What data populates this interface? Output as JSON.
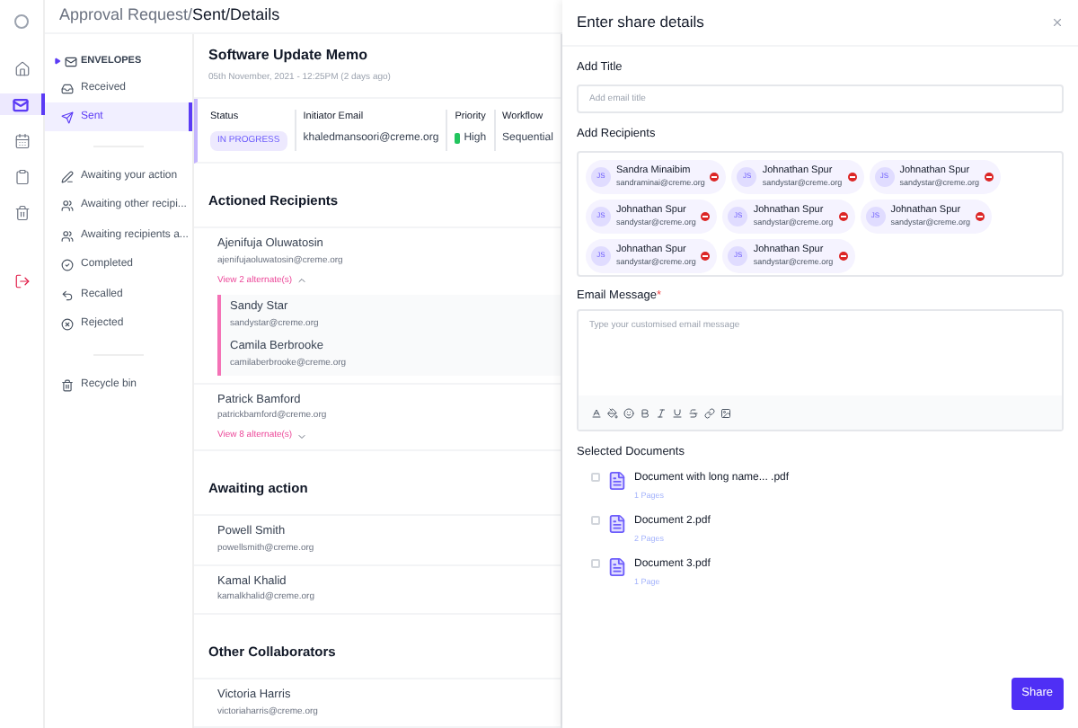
{
  "rail": [
    {
      "selected": false
    },
    {
      "selected": true
    },
    {
      "selected": false
    },
    {
      "selected": false
    },
    {
      "selected": false
    },
    {
      "selected": false
    }
  ],
  "breadcrumb": {
    "parent": "Approval Request/",
    "current": "Sent/Details"
  },
  "sidebar": {
    "group": {
      "label": "ENVELOPES",
      "expanded": true
    },
    "items": [
      {
        "label": "Received",
        "selected": false
      },
      {
        "label": "Sent",
        "selected": true
      }
    ],
    "filters": [
      "Awaiting your action",
      "Awaiting other recipi...",
      "Awaiting recipients a...",
      "Completed",
      "Recalled",
      "Rejected"
    ],
    "bin": "Recycle bin"
  },
  "document": {
    "title": "Software Update Memo",
    "date": "05th November, 2021 - 12:25PM (2 days ago)",
    "fields": [
      {
        "label": "Status",
        "value": "IN PROGRESS",
        "kind": "badge"
      },
      {
        "label": "Initiator Email",
        "value": "khaledmansoori@creme.org",
        "kind": "text"
      },
      {
        "label": "Priority",
        "value": "High",
        "kind": "priority"
      },
      {
        "label": "Workflow",
        "value": "Sequential",
        "kind": "text"
      }
    ]
  },
  "sections": [
    {
      "title": "Actioned Recipients",
      "people": [
        {
          "name": "Ajenifuja Oluwatosin",
          "email": "ajenifujaoluwatosin@creme.org",
          "toggle": {
            "label": "View 2 alternate(s)",
            "expanded": true
          },
          "alternates": [
            {
              "name": "Sandy Star",
              "email": "sandystar@creme.org"
            },
            {
              "name": "Camila Berbrooke",
              "email": "camilaberbrooke@creme.org"
            }
          ]
        },
        {
          "name": "Patrick Bamford",
          "email": "patrickbamford@creme.org",
          "toggle": {
            "label": "View 8 alternate(s)",
            "expanded": false
          }
        }
      ]
    },
    {
      "title": "Awaiting action",
      "people": [
        {
          "name": "Powell Smith",
          "email": "powellsmith@creme.org"
        },
        {
          "name": "Kamal Khalid",
          "email": "kamalkhalid@creme.org"
        }
      ]
    },
    {
      "title": "Other Collaborators",
      "people": [
        {
          "name": "Victoria Harris",
          "email": "victoriaharris@creme.org"
        }
      ]
    }
  ],
  "drawer": {
    "title": "Enter share details",
    "title_label": "Add Title",
    "title_placeholder": "Add email title",
    "recipients_label": "Add Recipients",
    "recipients": [
      {
        "initials": "JS",
        "name": "Sandra Minaibim",
        "email": "sandraminai@creme.org"
      },
      {
        "initials": "JS",
        "name": "Johnathan Spur",
        "email": "sandystar@creme.org"
      },
      {
        "initials": "JS",
        "name": "Johnathan Spur",
        "email": "sandystar@creme.org"
      },
      {
        "initials": "JS",
        "name": "Johnathan Spur",
        "email": "sandystar@creme.org"
      },
      {
        "initials": "JS",
        "name": "Johnathan Spur",
        "email": "sandystar@creme.org"
      },
      {
        "initials": "JS",
        "name": "Johnathan Spur",
        "email": "sandystar@creme.org"
      },
      {
        "initials": "JS",
        "name": "Johnathan Spur",
        "email": "sandystar@creme.org"
      },
      {
        "initials": "JS",
        "name": "Johnathan Spur",
        "email": "sandystar@creme.org"
      }
    ],
    "message_label": "Email Message",
    "required_mark": "*",
    "message_placeholder": "Type your customised email message",
    "documents_label": "Selected Documents",
    "documents": [
      {
        "name": "Document with long name... .pdf",
        "pages": "1 Pages",
        "checked": false
      },
      {
        "name": "Document 2.pdf",
        "pages": "2 Pages",
        "checked": false
      },
      {
        "name": "Document 3.pdf",
        "pages": "1 Page",
        "checked": false
      }
    ],
    "share": "Share"
  }
}
